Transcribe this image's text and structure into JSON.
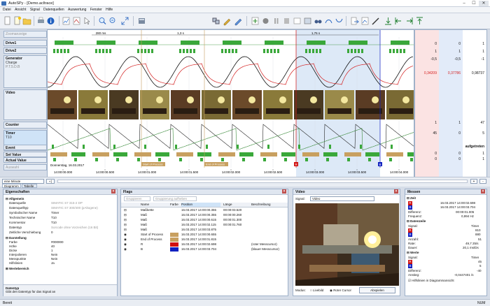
{
  "window": {
    "title": "AutoSPy - [Demo.acltrace]",
    "controls": [
      "–",
      "☐",
      "✕"
    ]
  },
  "menu": [
    "Datei",
    "Ansicht",
    "Signal",
    "Datenquellen",
    "Auswertung",
    "Fenster",
    "Hilfe"
  ],
  "toolbar": {
    "combo_value": "SIMATIC S7 315-2 DP"
  },
  "labels": {
    "zoom": "Zoomanzeige",
    "drive1": "Drive1",
    "drive2": "Drive2",
    "generator": "Generator",
    "charge": "Charge",
    "charge_sub": "P.T.5.D.B",
    "video": "Video",
    "counter": "Counter",
    "timer": "Timer",
    "t10": "T10",
    "event": "Event",
    "setvalue": "Set Value",
    "actualvalue": "Actual Value",
    "selection": "Auswahl"
  },
  "rulers": {
    "r1": "280 ms",
    "r2": "1,3 s",
    "r3": "1,76 s"
  },
  "markers": {
    "start": "Start of Process",
    "end": "End of Process",
    "r": "R",
    "b": "B"
  },
  "date_label": "Donnerstag, 16.03.2017",
  "time_ticks": [
    "14:00:00.000",
    "14:00:00.500",
    "14:00:01.000",
    "14:00:01.500",
    "14:00:02.000",
    "14:00:02.500",
    "14:00:03.000",
    "14:00:03.500",
    "14:00:04.000"
  ],
  "values": {
    "col1": [
      "0",
      "1",
      "-0,5",
      "0,34209",
      "1",
      "45",
      "0",
      "0"
    ],
    "col2": [
      "0",
      "1",
      "-0,5",
      "0,37786",
      "1",
      "0",
      "0",
      "0"
    ],
    "col3": [
      "1",
      "1",
      "-1",
      "0,98737",
      "47",
      "5",
      "aufgetreten",
      "1",
      "1"
    ]
  },
  "scroll": {
    "range": "eine Minute",
    "tab1": "Diagramm",
    "tab2": "Tabelle",
    "zoom_in": "+",
    "zoom_out": "-"
  },
  "props": {
    "title": "Eigenschaften",
    "sections": {
      "allgemein": "Allgemein",
      "darstellung": "Darstellung",
      "wertebereich": "Wertebereich"
    },
    "rows": [
      [
        "Datenquelle",
        "SIMATIC S7 315-2 DP"
      ],
      [
        "Datenquelltyp",
        "SIMATIC S7 300/400 (pAltogene)"
      ],
      [
        "Symbolischer Name",
        "Timer"
      ],
      [
        "Technischer Name",
        "T10"
      ],
      [
        "Kommentar",
        "T10"
      ],
      [
        "Datentyp",
        "Sorcode ohne Vorzeichen (16 Bit)"
      ],
      [
        "Zeitliche Verschiebung",
        "0"
      ]
    ],
    "drows": [
      [
        "Farbe",
        "#000000"
      ],
      [
        "Höhe",
        "40"
      ],
      [
        "Dicke",
        "1"
      ],
      [
        "Interpolieren",
        "Nein"
      ],
      [
        "Messpunkte",
        "Nein"
      ],
      [
        "Hilfslinien",
        "Ja"
      ]
    ],
    "help_title": "Datentyp",
    "help_text": "Gibt den Datentyp für das Signal an"
  },
  "flags": {
    "title": "Flags",
    "btn_group": "Gruppieren",
    "btn_ungroup": "Gruppierung aufheben",
    "headers": [
      "Name",
      "Farbe",
      "Position",
      "Länge",
      "Beschreibung"
    ],
    "rows": [
      [
        "Maßkette",
        "",
        "16.03.2017 14:00:00.355",
        "00:00:03.520",
        ""
      ],
      [
        "Maß",
        "",
        "16.03.2017 14:00:00.355",
        "00:00:00.260",
        ""
      ],
      [
        "Maß",
        "",
        "16.03.2017 14:00:00.615",
        "00:00:01.300",
        ""
      ],
      [
        "Maß",
        "",
        "16.03.2017 14:00:02.115",
        "00:00:01.760",
        ""
      ],
      [
        "Maß",
        "",
        "16.03.2017 14:00:03.875",
        "",
        ""
      ],
      [
        "Start of Process",
        "#c8a060",
        "16.03.2017 14:00:00.655",
        "",
        ""
      ],
      [
        "End of Process",
        "#c8a060",
        "16.03.2017 14:00:01.815",
        "",
        ""
      ],
      [
        "R",
        "#d01010",
        "16.03.2017 14:00:02.698",
        "",
        "(roter Messcursor)"
      ],
      [
        "B",
        "#1020c0",
        "16.03.2017 14:00:03.704",
        "",
        "(blauer Messcursor)"
      ]
    ]
  },
  "videopanel": {
    "title": "Video",
    "signal_label": "Signal:",
    "signal_value": "Video",
    "mode_label": "Modus:",
    "mode1": "Livebild",
    "mode2": "Roter Cursor",
    "play": "Abspielen"
  },
  "messen": {
    "title": "Messen",
    "zeit": "Zeit",
    "r_time": "16.03.2017 14:00:02.698",
    "b_time": "16.03.2017 14:00:03.704",
    "diff_label": "Differenz:",
    "diff": "00:00:01.005",
    "freq_label": "Frequenz:",
    "freq": "0,994 Hz",
    "datenaufzeit": "Datenzeile",
    "signal_label": "Signal:",
    "signal": "Timer",
    "r_val": "810",
    "b_val": "880",
    "anzahl_label": "Anzahl:",
    "anzahl": "51",
    "rate_label": "Rate:",
    "rate": "49,7 25/s",
    "dauer_label": "Dauer:",
    "dauer": "20,1 ms/Ds",
    "werte": "Werte",
    "w_signal": "Timer",
    "w_r": "45",
    "w_b": "5",
    "w_diff_label": "Differenz:",
    "w_diff": "-40",
    "w_anstieg_label": "Anstieg:",
    "w_anstieg": "-0,0447401 /s",
    "checkbox": "Hilfslinien in Diagrammansicht"
  },
  "status": {
    "left": "Bereit",
    "right": "NUM"
  }
}
